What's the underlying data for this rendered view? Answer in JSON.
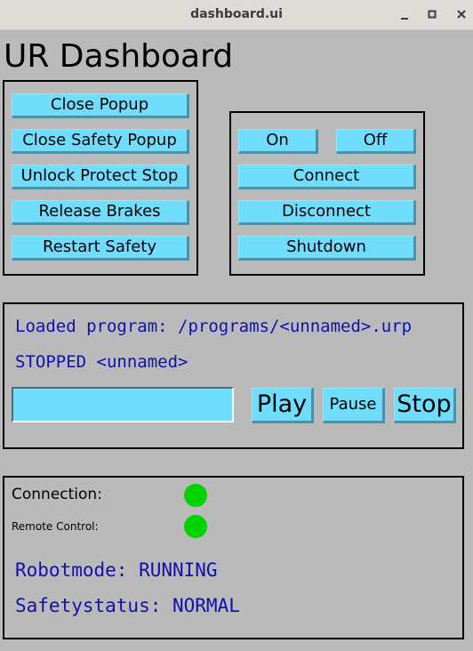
{
  "window": {
    "title": "dashboard.ui",
    "controls": {
      "minimize": "minimize-icon",
      "maximize": "maximize-icon",
      "close": "close-icon"
    }
  },
  "app": {
    "title": "UR Dashboard"
  },
  "popup_panel": {
    "buttons": [
      {
        "label": "Close Popup"
      },
      {
        "label": "Close Safety Popup"
      },
      {
        "label": "Unlock Protect Stop"
      },
      {
        "label": "Release Brakes"
      },
      {
        "label": "Restart Safety"
      }
    ]
  },
  "power_panel": {
    "on_label": "On",
    "off_label": "Off",
    "connect_label": "Connect",
    "disconnect_label": "Disconnect",
    "shutdown_label": "Shutdown"
  },
  "program_panel": {
    "loaded_program": "Loaded program: /programs/<unnamed>.urp",
    "program_state": "STOPPED <unnamed>",
    "program_input": {
      "value": "",
      "placeholder": ""
    },
    "play_label": "Play",
    "pause_label": "Pause",
    "stop_label": "Stop"
  },
  "status_panel": {
    "connection_label": "Connection:",
    "connection_status": "connected",
    "remote_control_label": "Remote Control:",
    "remote_control_status": "enabled",
    "robotmode": "Robotmode: RUNNING",
    "safetystatus": "Safetystatus: NORMAL"
  },
  "colors": {
    "background": "#bababa",
    "button": "#70ddfd",
    "status_text": "#1010b0",
    "indicator_on": "#00d400"
  }
}
